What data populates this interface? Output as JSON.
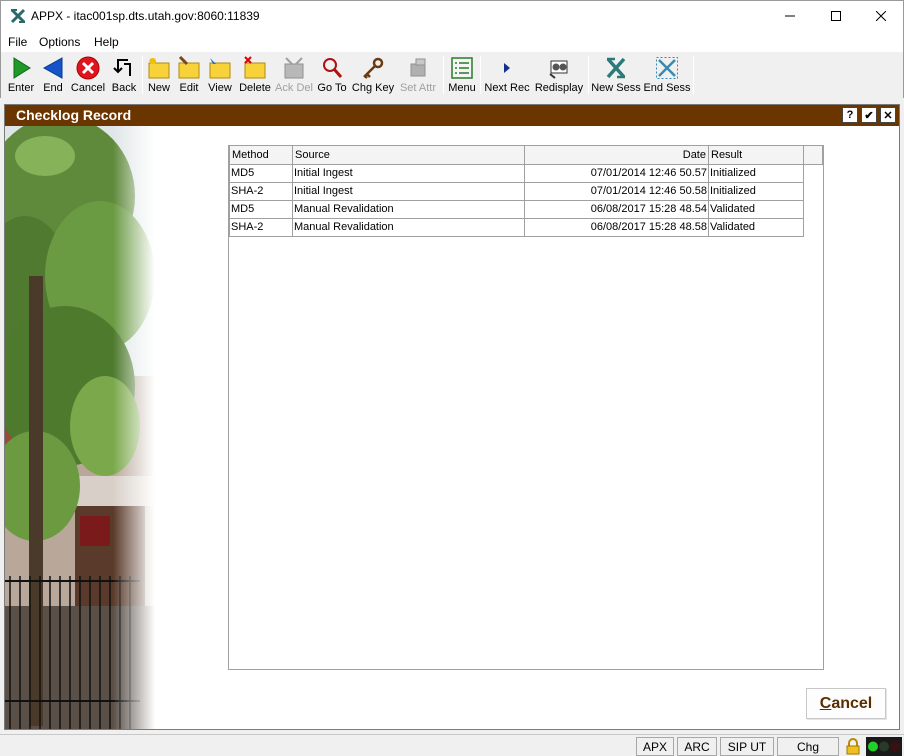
{
  "window": {
    "title": "APPX - itac001sp.dts.utah.gov:8060:11839"
  },
  "menu": [
    "File",
    "Options",
    "Help"
  ],
  "toolbar": {
    "enter": "Enter",
    "end": "End",
    "cancel": "Cancel",
    "back": "Back",
    "new": "New",
    "edit": "Edit",
    "view": "View",
    "delete": "Delete",
    "ack_del": "Ack Del",
    "go_to": "Go To",
    "chg_key": "Chg Key",
    "set_attr": "Set Attr",
    "menu": "Menu",
    "next_rec": "Next Rec",
    "redisplay": "Redisplay",
    "new_sess": "New Sess",
    "end_sess": "End Sess"
  },
  "panel": {
    "title": "Checklog Record",
    "help_btn": "?",
    "ok_btn": "✔",
    "close_btn": "✕"
  },
  "table": {
    "headers": [
      "Method",
      "Source",
      "Date",
      "Result"
    ],
    "rows": [
      [
        "MD5",
        "Initial Ingest",
        "07/01/2014 12:46 50.57",
        "Initialized"
      ],
      [
        "SHA-2",
        "Initial Ingest",
        "07/01/2014 12:46 50.58",
        "Initialized"
      ],
      [
        "MD5",
        "Manual Revalidation",
        "06/08/2017 15:28 48.54",
        "Validated"
      ],
      [
        "SHA-2",
        "Manual Revalidation",
        "06/08/2017 15:28 48.58",
        "Validated"
      ]
    ]
  },
  "cancel_button": {
    "first_letter": "C",
    "rest": "ancel"
  },
  "status": [
    "APX",
    "ARC",
    "SIP UT",
    "Chg"
  ],
  "colors": {
    "header": "#6b3500",
    "accent": "#5a2d00"
  }
}
